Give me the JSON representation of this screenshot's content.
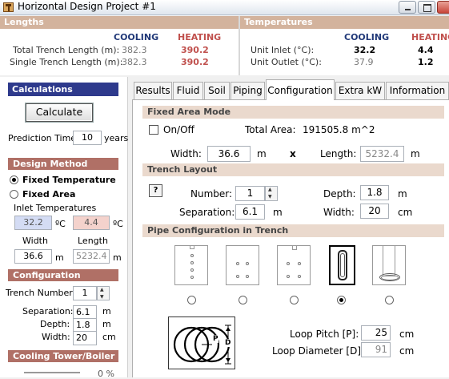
{
  "window": {
    "title": "Horizontal Design Project #1"
  },
  "summary": {
    "lengths_title": "Lengths",
    "temps_title": "Temperatures",
    "cooling_label": "COOLING",
    "heating_label": "HEATING",
    "rows_left": [
      {
        "label": "Total Trench Length (m):",
        "cooling": "382.3",
        "heating": "390.2"
      },
      {
        "label": "Single Trench Length (m):",
        "cooling": "382.3",
        "heating": "390.2"
      }
    ],
    "rows_right": [
      {
        "label": "Unit Inlet (°C):",
        "cooling": "32.2",
        "heating": "4.4"
      },
      {
        "label": "Unit Outlet (°C):",
        "cooling": "37.9",
        "heating": "1.2"
      }
    ]
  },
  "left": {
    "calc_title": "Calculations",
    "calc_button": "Calculate",
    "prediction_label": "Prediction Time:",
    "prediction_value": "10",
    "prediction_unit": "years",
    "design_method_title": "Design Method",
    "method_fixed_temp": "Fixed Temperature",
    "method_fixed_area": "Fixed Area",
    "inlet_temps_label": "Inlet Temperatures",
    "inlet_cool": "32.2",
    "inlet_heat": "4.4",
    "deg_unit": "ºC",
    "width_label": "Width",
    "length_label": "Length",
    "width_value": "36.6",
    "length_value": "5232.4",
    "m_unit": "m",
    "config_title": "Configuration",
    "trench_number_label": "Trench Number:",
    "trench_number_value": "1",
    "separation_label": "Separation:",
    "separation_value": "6.1",
    "depth_label": "Depth:",
    "depth_value": "1.8",
    "width2_label": "Width:",
    "width2_value": "20",
    "cm_unit": "cm",
    "cooling_tower_title": "Cooling Tower/Boiler",
    "percent_label": "0 %"
  },
  "tabs": [
    "Results",
    "Fluid",
    "Soil",
    "Piping",
    "Configuration",
    "Extra kW",
    "Information"
  ],
  "config": {
    "fixed_area_title": "Fixed Area Mode",
    "onoff_label": "On/Off",
    "total_area_label": "Total Area:",
    "total_area_value": "191505.8 m^2",
    "width_label": "Width:",
    "width_value": "36.6",
    "x_label": "x",
    "length_label": "Length:",
    "length_value": "5232.4",
    "m_unit": "m",
    "trench_layout_title": "Trench Layout",
    "help_label": "?",
    "number_label": "Number:",
    "number_value": "1",
    "separation_label": "Separation:",
    "separation_value": "6.1",
    "depth_label": "Depth:",
    "depth_value": "1.8",
    "width2_label": "Width:",
    "width2_value": "20",
    "cm_unit": "cm",
    "pipe_config_title": "Pipe Configuration in Trench",
    "loop_pitch_label": "Loop Pitch [P]:",
    "loop_pitch_value": "25",
    "loop_diameter_label": "Loop Diameter [D]:",
    "loop_diameter_value": "91",
    "diagram_p": "P",
    "diagram_d": "D"
  }
}
